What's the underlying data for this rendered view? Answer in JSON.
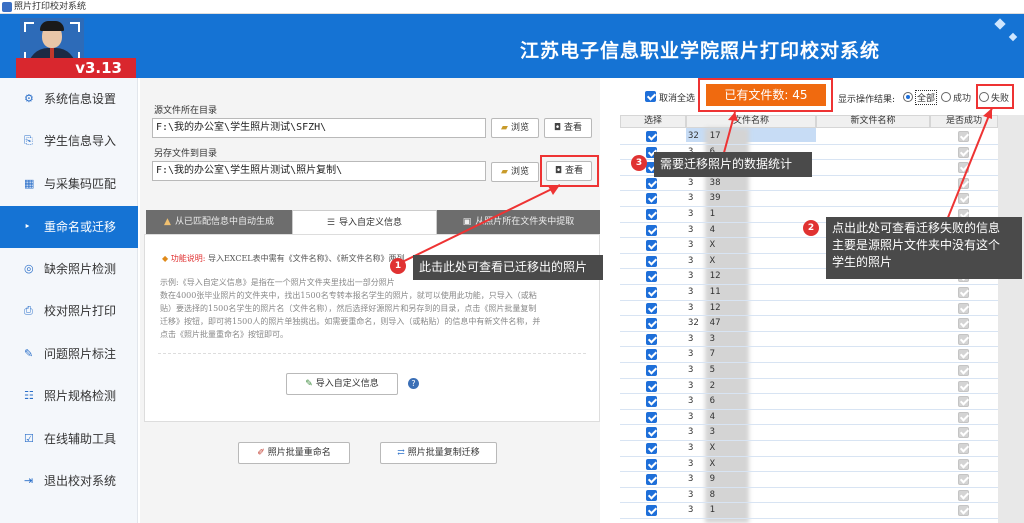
{
  "window": {
    "title": "照片打印校对系统"
  },
  "header": {
    "version": "v3.13",
    "app_title": "江苏电子信息职业学院照片打印校对系统"
  },
  "sidebar": {
    "items": [
      {
        "label": "系统信息设置",
        "icon": "⚙"
      },
      {
        "label": "学生信息导入",
        "icon": "⎘"
      },
      {
        "label": "与采集码匹配",
        "icon": "▦"
      },
      {
        "label": "重命名或迁移",
        "icon": "‣"
      },
      {
        "label": "缺余照片检测",
        "icon": "◎"
      },
      {
        "label": "校对照片打印",
        "icon": "⎙"
      },
      {
        "label": "问题照片标注",
        "icon": "✎"
      },
      {
        "label": "照片规格检测",
        "icon": "☷"
      },
      {
        "label": "在线辅助工具",
        "icon": "☑"
      },
      {
        "label": "退出校对系统",
        "icon": "⇥"
      }
    ]
  },
  "main": {
    "source_label": "源文件所在目录",
    "source_path": "F:\\我的办公室\\学生照片测试\\SFZH\\",
    "target_label": "另存文件到目录",
    "target_path": "F:\\我的办公室\\学生照片测试\\照片复制\\",
    "browse_label": "浏览",
    "view_label": "查看",
    "tabs": [
      "从已匹配信息中自动生成",
      "导入自定义信息",
      "从照片所在文件夹中提取"
    ],
    "hint_title": "功能说明:",
    "hint_text": "导入EXCEL表中需有《文件名称》、《新文件名称》两列",
    "example_lines": [
      "示例:《导入自定义信息》是指在一个照片文件夹里找出一部分照片",
      "数在4000张毕业照片的文件夹中，找出1500名专转本报名学生的照片，就可以使用此功能，只导入（或粘",
      "贴）要选择的1500名学生的照片名（文件名称），然后选择好源照片和另存到的目录，点击《照片批量复制",
      "迁移》按钮，即可将1500人的照片单独挑出。如需要重命名，则导入（或粘贴）的信息中有新文件名称，并",
      "点击《照片批量重命名》按钮即可。"
    ],
    "import_button": "导入自定义信息",
    "rename_button": "照片批量重命名",
    "copy_button": "照片批量复制迁移"
  },
  "grid": {
    "uncheck_all": "取消全选",
    "file_count": "已有文件数: 45",
    "result_label": "显示操作结果:",
    "filters": [
      "全部",
      "成功",
      "失败"
    ],
    "columns": [
      "选择",
      "文件名称",
      "新文件名称",
      "是否成功"
    ],
    "row_ids": [
      "32  17",
      "3   6",
      "3   X",
      "3   38",
      "3   39",
      "3   1",
      "3   4",
      "3   X",
      "3   X",
      "3   12",
      "3   11",
      "3   12",
      "32  47",
      "3   3",
      "3   7",
      "3   5",
      "3   2",
      "3   6",
      "3   4",
      "3   3",
      "3   X",
      "3   X",
      "3   9",
      "3   8",
      "3   1"
    ]
  },
  "annotations": {
    "c1": {
      "num": "1",
      "text": "此击此处可查看已迁移出的照片"
    },
    "c2": {
      "num": "2",
      "text": [
        "点出此处可查看迁移失败的信息",
        "主要是源照片文件夹中没有这个",
        "学生的照片"
      ]
    },
    "c3": {
      "num": "3",
      "text": "需要迁移照片的数据统计"
    }
  }
}
